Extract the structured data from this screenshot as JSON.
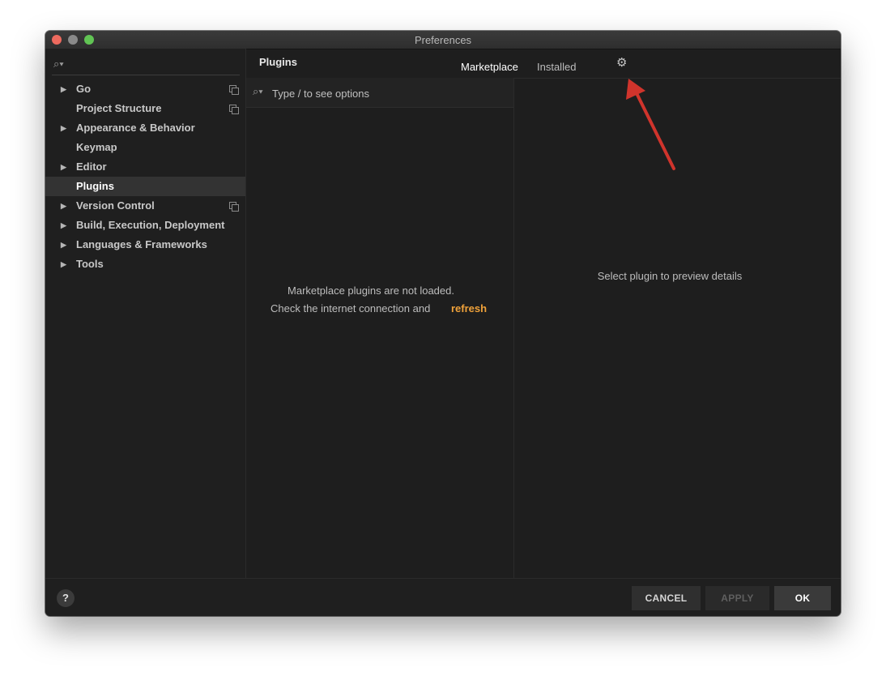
{
  "window": {
    "title": "Preferences"
  },
  "sidebar": {
    "search_icon": "search-icon",
    "items": [
      {
        "label": "Go",
        "expandable": true,
        "project_icon": true,
        "selected": false
      },
      {
        "label": "Project Structure",
        "expandable": false,
        "project_icon": true,
        "selected": false
      },
      {
        "label": "Appearance & Behavior",
        "expandable": true,
        "project_icon": false,
        "selected": false
      },
      {
        "label": "Keymap",
        "expandable": false,
        "project_icon": false,
        "selected": false
      },
      {
        "label": "Editor",
        "expandable": true,
        "project_icon": false,
        "selected": false
      },
      {
        "label": "Plugins",
        "expandable": false,
        "project_icon": false,
        "selected": true
      },
      {
        "label": "Version Control",
        "expandable": true,
        "project_icon": true,
        "selected": false
      },
      {
        "label": "Build, Execution, Deployment",
        "expandable": true,
        "project_icon": false,
        "selected": false
      },
      {
        "label": "Languages & Frameworks",
        "expandable": true,
        "project_icon": false,
        "selected": false
      },
      {
        "label": "Tools",
        "expandable": true,
        "project_icon": false,
        "selected": false
      }
    ]
  },
  "header": {
    "title": "Plugins",
    "tabs": [
      {
        "label": "Marketplace",
        "active": true
      },
      {
        "label": "Installed",
        "active": false
      }
    ],
    "gear_icon": "gear-icon"
  },
  "plugin_list": {
    "search_placeholder": "Type / to see options",
    "message_line1": "Marketplace plugins are not loaded.",
    "message_line2": "Check the internet connection and",
    "refresh_link": "refresh"
  },
  "details": {
    "message": "Select plugin to preview details"
  },
  "footer": {
    "help_label": "?",
    "cancel_label": "CANCEL",
    "apply_label": "APPLY",
    "ok_label": "OK"
  },
  "colors": {
    "accent_link": "#f0a23a",
    "annotation_arrow": "#d0342c"
  }
}
